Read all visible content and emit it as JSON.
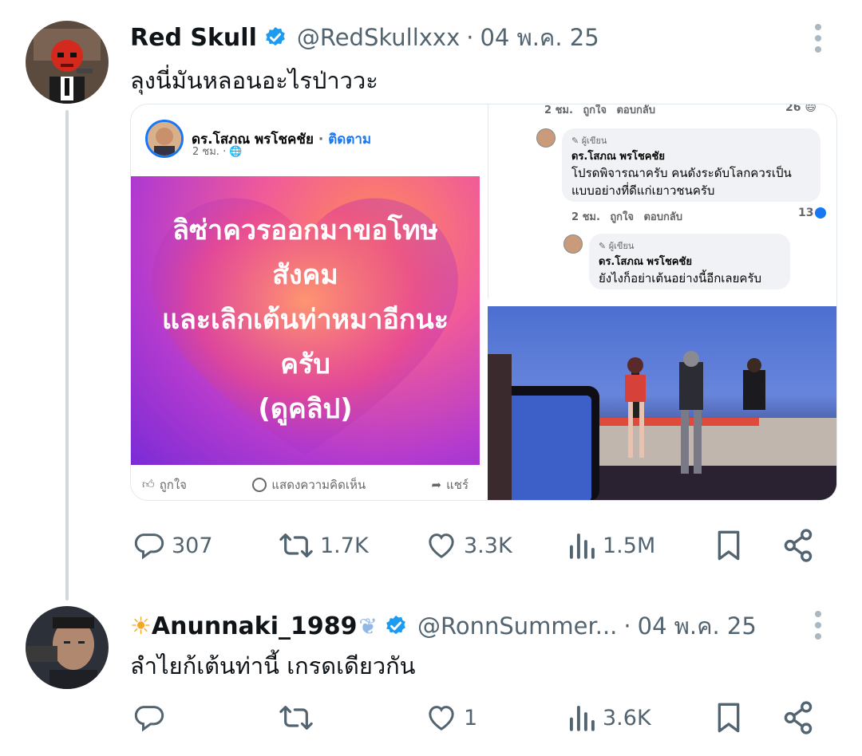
{
  "posts": [
    {
      "display_name": "Red Skull",
      "handle": "@RedSkullxxx",
      "time": "04 พ.ค. 25",
      "text": "ลุงนี่มันหลอนอะไรป่าววะ",
      "stats": {
        "replies": "307",
        "reposts": "1.7K",
        "likes": "3.3K",
        "views": "1.5M"
      }
    },
    {
      "display_name": "Anunnaki_1989",
      "handle": "@RonnSummer...",
      "time": "04 พ.ค. 25",
      "text": "ลำไยก้เต้นท่านี้ เกรดเดียวกัน",
      "stats": {
        "replies": "",
        "reposts": "",
        "likes": "1",
        "views": "3.6K"
      }
    }
  ],
  "fb_card": {
    "name": "ดร.โสภณ พรโชคชัย",
    "follow": "ติดตาม",
    "time": "2 ชม.",
    "image_lines": [
      "ลิซ่าควรออกมาขอโทษ",
      "สังคม",
      "และเลิกเต้นท่าหมาอีกนะ",
      "ครับ",
      "(ดูคลิป)"
    ],
    "like_label": "ถูกใจ",
    "comment_label": "แสดงความคิดเห็น",
    "share_label": "แชร์"
  },
  "fb_comments": {
    "top_meta": {
      "time": "2 ชม.",
      "like": "ถูกใจ",
      "reply": "ตอบกลับ",
      "count": "26"
    },
    "items": [
      {
        "author_tag": "ผู้เขียน",
        "name": "ดร.โสภณ พรโชคชัย",
        "lines": [
          "โปรดพิจารณาครับ คนดังระดับโลกควรเป็น",
          "แบบอย่างที่ดีแก่เยาวชนครับ"
        ],
        "time": "2 ชม.",
        "like": "ถูกใจ",
        "reply": "ตอบกลับ",
        "count": "13"
      },
      {
        "author_tag": "ผู้เขียน",
        "name": "ดร.โสภณ พรโชคชัย",
        "lines": [
          "ยังไงก็อย่าเต้นอย่างนี้อีกเลยครับ"
        ]
      }
    ]
  },
  "colors": {
    "verified": "#1d9bf0",
    "muted": "#536471",
    "thread_line": "#cfd9de",
    "fb_blue": "#1877f2"
  },
  "icons": [
    "verified-badge-icon",
    "more-icon",
    "reply-icon",
    "repost-icon",
    "like-icon",
    "views-icon",
    "bookmark-icon",
    "share-icon"
  ]
}
